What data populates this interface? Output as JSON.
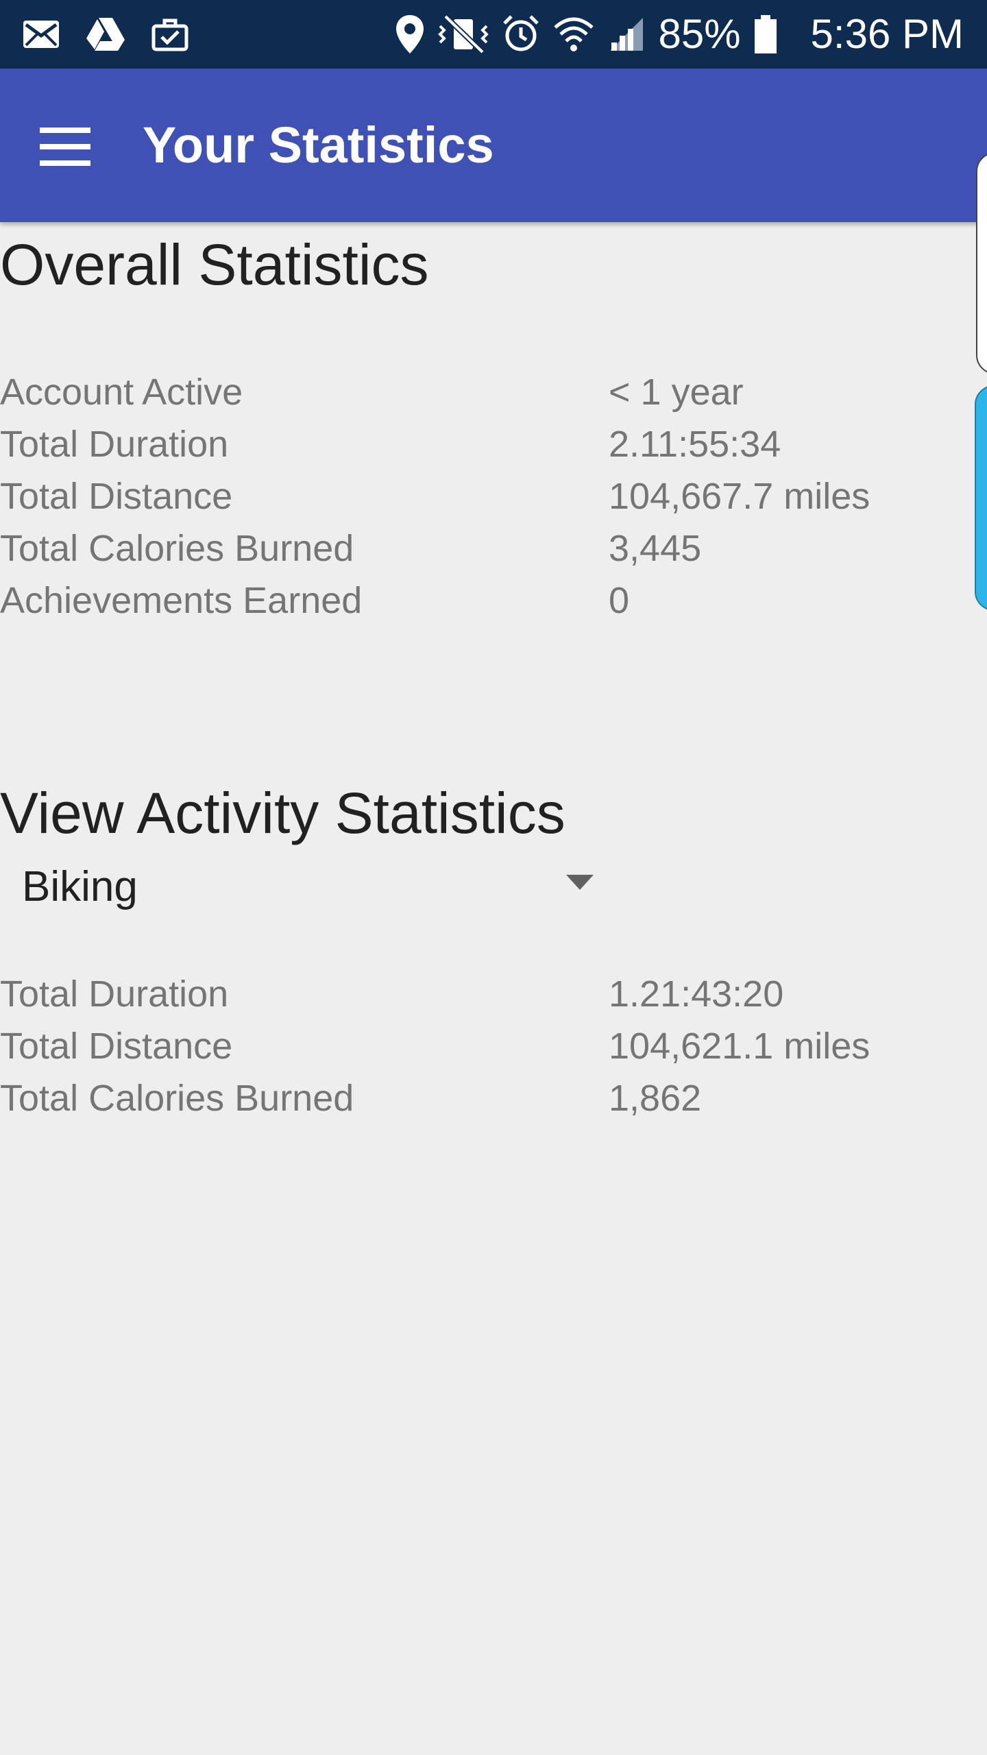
{
  "status_bar": {
    "battery_percent": "85%",
    "time": "5:36 PM",
    "left_icons": [
      "mail-icon",
      "drive-icon",
      "briefcase-check-icon"
    ],
    "right_icons": [
      "location-icon",
      "vibrate-mute-icon",
      "alarm-icon",
      "wifi-icon",
      "signal-icon",
      "battery-icon"
    ]
  },
  "app_bar": {
    "title": "Your Statistics",
    "menu_icon": "hamburger-menu-icon",
    "color": "#3f51b5"
  },
  "overall": {
    "title": "Overall Statistics",
    "rows": [
      {
        "label": "Account Active",
        "value": "< 1 year"
      },
      {
        "label": "Total Duration",
        "value": "2.11:55:34"
      },
      {
        "label": "Total Distance",
        "value": "104,667.7 miles"
      },
      {
        "label": "Total Calories Burned",
        "value": "3,445"
      },
      {
        "label": "Achievements Earned",
        "value": "0"
      }
    ]
  },
  "activity": {
    "title": "View Activity Statistics",
    "selected_activity": "Biking",
    "rows": [
      {
        "label": "Total Duration",
        "value": "1.21:43:20"
      },
      {
        "label": "Total Distance",
        "value": "104,621.1 miles"
      },
      {
        "label": "Total Calories Burned",
        "value": "1,862"
      }
    ]
  },
  "colors": {
    "status_bar": "#0e2b50",
    "background": "#eeeeee",
    "edge_accent": "#2bb5e8"
  }
}
